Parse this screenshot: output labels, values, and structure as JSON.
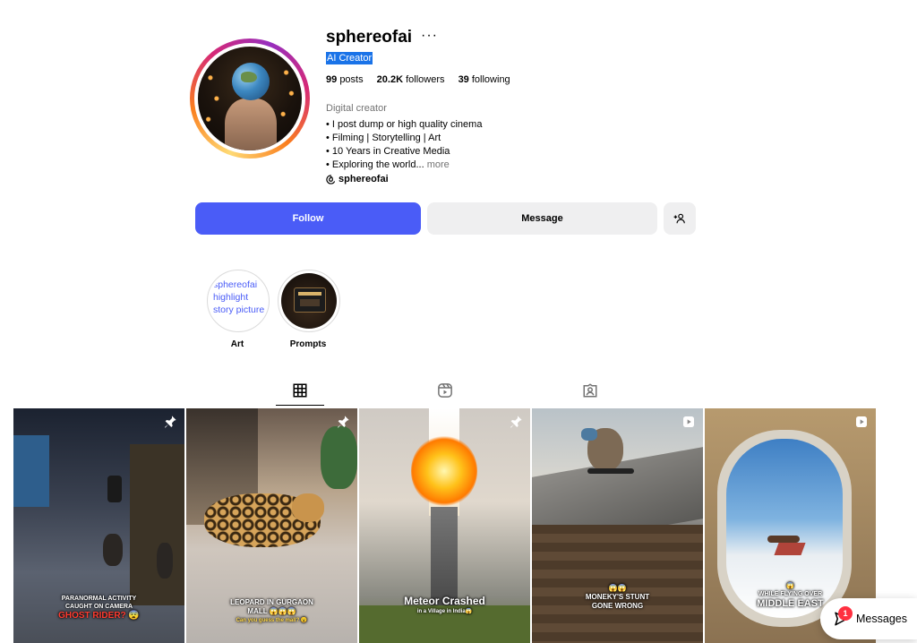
{
  "profile": {
    "username": "sphereofai",
    "more_menu": "···",
    "category": "AI Creator",
    "stats": {
      "posts_count": "99",
      "posts_label": "posts",
      "followers_count": "20.2K",
      "followers_label": "followers",
      "following_count": "39",
      "following_label": "following"
    },
    "bio_category": "Digital creator",
    "bio_lines": [
      "• I post dump or high quality cinema",
      "• Filming | Storytelling | Art",
      "• 10 Years in Creative Media",
      "• Exploring the world..."
    ],
    "bio_more": "more",
    "threads_handle": "sphereofai"
  },
  "actions": {
    "follow": "Follow",
    "message": "Message"
  },
  "highlights": [
    {
      "label": "Art",
      "cover_text": "sphereofai highlight story picture"
    },
    {
      "label": "Prompts"
    }
  ],
  "posts": [
    {
      "caption_line1": "PARANORMAL ACTIVITY",
      "caption_line2": "CAUGHT ON CAMERA",
      "caption_line3": "GHOST RIDER? 😨",
      "pinned": true
    },
    {
      "caption_line1": "LEOPARD IN GURGAON",
      "caption_line2": "MALL 😱😱😱",
      "caption_line3": "Can you guess the mall? 😮",
      "pinned": true
    },
    {
      "caption_line1": "Meteor Crashed",
      "caption_line2": "in a Village in India😱",
      "pinned": true
    },
    {
      "caption_line1": "😱😱",
      "caption_line2": "MONEKY'S STUNT",
      "caption_line3": "GONE WRONG",
      "type": "reel"
    },
    {
      "caption_line1": "😱",
      "caption_line2": "WHILE FLYING OVER",
      "caption_line3": "MIDDLE EAST",
      "type": "reel"
    }
  ],
  "messages": {
    "label": "Messages",
    "badge": "1"
  },
  "colors": {
    "follow_button": "#4a5cf7",
    "secondary_button": "#efeff0",
    "badge": "#ff3040"
  }
}
